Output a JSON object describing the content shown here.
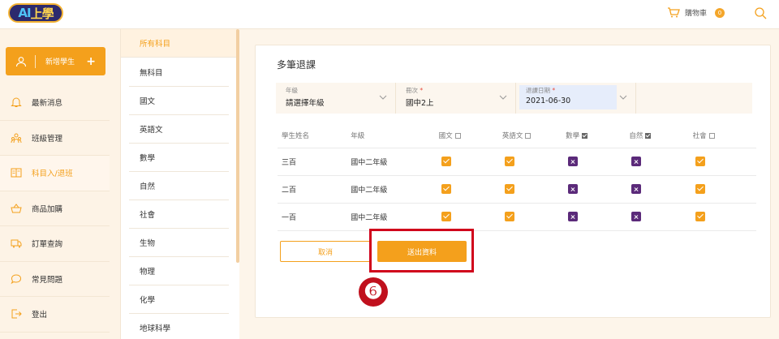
{
  "header": {
    "logo_text_a": "A",
    "logo_text_b": "I",
    "logo_text_c": "上學",
    "cart_label": "購物車",
    "cart_count": "0"
  },
  "sidebar": {
    "add_student_label": "新增學生",
    "items": [
      {
        "label": "最新消息",
        "icon": "bell-icon"
      },
      {
        "label": "班級管理",
        "icon": "users-icon"
      },
      {
        "label": "科目入/退班",
        "icon": "book-icon",
        "active": true
      },
      {
        "label": "商品加購",
        "icon": "basket-icon"
      },
      {
        "label": "訂單查詢",
        "icon": "truck-icon"
      },
      {
        "label": "常見問題",
        "icon": "chat-icon"
      },
      {
        "label": "登出",
        "icon": "logout-icon"
      }
    ]
  },
  "subjects": [
    "所有科目",
    "無科目",
    "國文",
    "英語文",
    "數學",
    "自然",
    "社會",
    "生物",
    "物理",
    "化學",
    "地球科學"
  ],
  "card": {
    "title": "多筆退課",
    "filters": {
      "grade_label": "年級",
      "grade_value": "請選擇年級",
      "term_label": "冊次",
      "term_required": "*",
      "term_value": "國中2上",
      "date_label": "退課日期",
      "date_required": "*",
      "date_value": "2021-06-30"
    },
    "table": {
      "headers": {
        "name": "學生姓名",
        "grade": "年級",
        "s1": "國文",
        "s2": "英語文",
        "s3": "數學",
        "s4": "自然",
        "s5": "社會"
      },
      "header_checked": [
        false,
        false,
        true,
        true,
        false
      ],
      "rows": [
        {
          "name": "三百",
          "grade": "國中二年級",
          "marks": [
            "check",
            "check",
            "cross",
            "cross",
            "check"
          ]
        },
        {
          "name": "二百",
          "grade": "國中二年級",
          "marks": [
            "check",
            "check",
            "cross",
            "cross",
            "check"
          ]
        },
        {
          "name": "一百",
          "grade": "國中二年級",
          "marks": [
            "check",
            "check",
            "cross",
            "cross",
            "check"
          ]
        }
      ]
    },
    "cancel_label": "取消",
    "submit_label": "送出資料"
  },
  "annotation": {
    "step_number": "❻",
    "highlight_color": "#d0021b"
  },
  "colors": {
    "accent": "#f4a01c",
    "cross": "#5b2a7a",
    "background": "#fdf5ea"
  }
}
